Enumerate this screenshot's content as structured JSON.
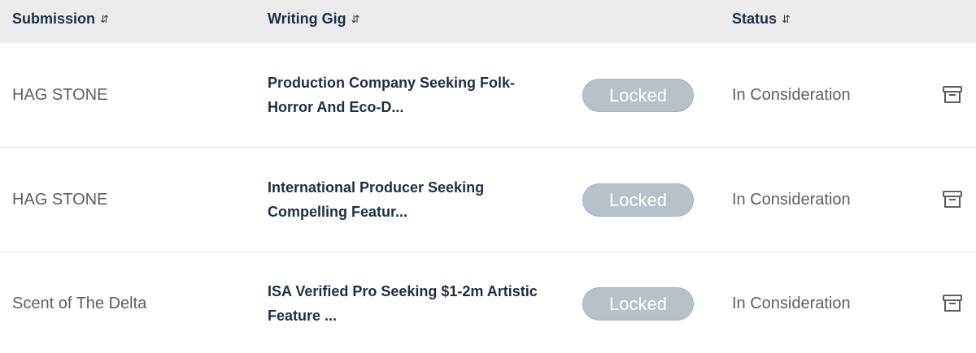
{
  "header": {
    "submission": "Submission",
    "writing_gig": "Writing Gig",
    "status": "Status",
    "sort_glyph": "⇵"
  },
  "rows": [
    {
      "submission": "HAG STONE",
      "gig_line1": "Production Company Seeking Folk-",
      "gig_line2": "Horror And Eco-D...",
      "badge": "Locked",
      "status": "In Consideration"
    },
    {
      "submission": "HAG STONE",
      "gig_line1": "International Producer Seeking",
      "gig_line2": "Compelling Featur...",
      "badge": "Locked",
      "status": "In Consideration"
    },
    {
      "submission": "Scent of The Delta",
      "gig_line1": "ISA Verified Pro Seeking $1-2m Artistic",
      "gig_line2": "Feature ...",
      "badge": "Locked",
      "status": "In Consideration"
    }
  ],
  "icons": {
    "sort": "sort-icon",
    "archive": "archive-icon"
  },
  "colors": {
    "header_bg": "#ebebeb",
    "heading_text": "#1c2f47",
    "body_text": "#5f5f5f",
    "locked_badge": "#b7c1c9"
  }
}
